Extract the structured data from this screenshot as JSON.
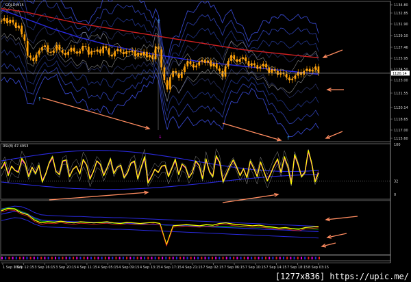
{
  "chart_data": [
    {
      "type": "line",
      "panel": "price",
      "title": "GOLD,M15",
      "ylim": [
        1105.5,
        1135.5
      ],
      "y_ticks": [
        "1134.80",
        "1132.85",
        "1131.90",
        "1129.10",
        "1127.46",
        "1125.95",
        "1124.50",
        "1123.00",
        "1121.55",
        "1120.14",
        "1118.65",
        "1117.00",
        "1115.60"
      ],
      "price_label": "1120.14",
      "series": [
        {
          "name": "",
          "color": "#ffa000",
          "values": [
            1131.5,
            1132.2,
            1131.0,
            1131.8,
            1131.2,
            1130.0,
            1130.5,
            1128.6,
            1127.2,
            1124.0,
            1123.5,
            1122.8,
            1124.2,
            1125.1,
            1125.8,
            1126.2,
            1124.8,
            1124.6,
            1125.1,
            1126.3,
            1125.2,
            1124.6,
            1124.1,
            1124.8,
            1125.7,
            1124.9,
            1124.4,
            1125.0,
            1126.1,
            1125.9,
            1124.2,
            1125.0,
            1124.8,
            1125.3,
            1124.5,
            1126.0,
            1125.6,
            1124.2,
            1123.8,
            1124.9,
            1125.4,
            1124.8,
            1124.3,
            1124.9,
            1124.7,
            1125.1,
            1123.8,
            1124.6,
            1124.0,
            1124.8,
            1123.6,
            1124.1,
            1123.2,
            1126.0,
            1125.3,
            1121.4,
            1118.6,
            1116.6,
            1119.3,
            1120.6,
            1120.2,
            1119.1,
            1120.4,
            1121.6,
            1122.8,
            1122.1,
            1121.4,
            1121.8,
            1122.6,
            1123.0,
            1122.4,
            1122.9,
            1121.6,
            1122.3,
            1121.2,
            1120.6,
            1119.4,
            1121.6,
            1122.8,
            1124.1,
            1123.2,
            1122.6,
            1123.2,
            1123.6,
            1122.8,
            1121.7,
            1122.3,
            1121.9,
            1121.1,
            1121.6,
            1122.2,
            1121.4,
            1120.2,
            1121.0,
            1120.6,
            1119.8,
            1120.3,
            1120.0,
            1119.2,
            1118.6,
            1118.9,
            1119.6,
            1120.4,
            1119.8,
            1120.6,
            1121.1,
            1120.5,
            1120.9,
            1121.6,
            1120.2
          ]
        },
        {
          "name": "",
          "color": "#d02020",
          "values": [
            1134.2,
            1134.0,
            1133.7,
            1133.4,
            1133.0,
            1132.6,
            1132.2,
            1131.8,
            1131.4,
            1131.0,
            1130.7,
            1130.4,
            1130.1,
            1129.8,
            1129.5,
            1129.2,
            1128.9,
            1128.6,
            1128.3,
            1128.0,
            1127.7,
            1127.4,
            1127.1,
            1126.8,
            1126.5,
            1126.2,
            1125.9,
            1125.6,
            1125.3,
            1125.1,
            1124.9,
            1124.7,
            1124.5,
            1124.3,
            1124.1,
            1123.9,
            1123.7,
            1123.5
          ]
        },
        {
          "name": "",
          "color": "#2a2ae0",
          "values": [
            1133.9,
            1133.3,
            1132.6,
            1131.9,
            1131.2,
            1130.5,
            1129.8,
            1129.2,
            1128.6,
            1128.0,
            1127.5,
            1127.0,
            1126.5,
            1126.1,
            1125.7,
            1125.3,
            1124.9,
            1124.5,
            1124.2,
            1123.9,
            1123.6,
            1123.3,
            1123.0,
            1122.7,
            1122.5,
            1122.3,
            1122.1,
            1121.9,
            1121.7,
            1121.5,
            1121.3,
            1121.1,
            1120.9,
            1120.7,
            1120.5,
            1120.3,
            1120.1,
            1119.9
          ]
        }
      ],
      "annotations": {
        "arrows_count": 6,
        "arrow_color": "#ff8c60",
        "top_arrow_color": "#3aa8ff"
      }
    },
    {
      "type": "line",
      "panel": "oscillator",
      "title": "RSI(8) 47.4953",
      "ylim": [
        0,
        100
      ],
      "y_ticks": [
        "100",
        "32",
        "0"
      ],
      "series": [
        {
          "name": "",
          "color": "#ffff00",
          "values": [
            55,
            68,
            42,
            60,
            52,
            48,
            75,
            65,
            40,
            58,
            46,
            62,
            30,
            45,
            66,
            78,
            50,
            44,
            70,
            72,
            40,
            54,
            60,
            45,
            73,
            62,
            35,
            50,
            70,
            64,
            42,
            56,
            74,
            46,
            58,
            62,
            38,
            48,
            66,
            70,
            36,
            58,
            78,
            28,
            40,
            54,
            48,
            60,
            62,
            40,
            56,
            73,
            44,
            64,
            58,
            38,
            48,
            70,
            62,
            36,
            74,
            50,
            40,
            80,
            68,
            30,
            45,
            60,
            72,
            58,
            42,
            55,
            38,
            70,
            56,
            40,
            68,
            50,
            32,
            46,
            62,
            74,
            48,
            78,
            60,
            26,
            82,
            64,
            40,
            48,
            90,
            66,
            30,
            47
          ]
        },
        {
          "name": "",
          "color": "#e000e0",
          "values": [
            57,
            64,
            46,
            60,
            52,
            50,
            72,
            64,
            42,
            58,
            47,
            61,
            32,
            45,
            65,
            76,
            50,
            45,
            69,
            71,
            41,
            54,
            60,
            46,
            72,
            62,
            37,
            50,
            70,
            63,
            43,
            56,
            73,
            47,
            58,
            61,
            39,
            48,
            66,
            69,
            37,
            58,
            76,
            30,
            41,
            54,
            48,
            60,
            61,
            41,
            56,
            71,
            45,
            63,
            57,
            39,
            48,
            69,
            61,
            37,
            73,
            50,
            41,
            78,
            67,
            31,
            46,
            60,
            71,
            57,
            43,
            55,
            39,
            69,
            56,
            41,
            67,
            50,
            33,
            47,
            61,
            73,
            48,
            76,
            60,
            28,
            80,
            63,
            41,
            48,
            88,
            65,
            31,
            48
          ]
        }
      ]
    },
    {
      "type": "line",
      "panel": "oscillator",
      "title": "",
      "series": [
        {
          "name": "",
          "color": "#ffff00",
          "values": [
            0.62,
            0.7,
            0.68,
            0.55,
            0.48,
            0.3,
            0.2,
            0.24,
            0.22,
            0.26,
            0.22,
            0.2,
            0.24,
            0.22,
            0.2,
            0.22,
            0.24,
            0.2,
            0.18,
            0.22,
            0.2,
            0.18,
            0.2,
            0.22,
            0.18,
            -0.55,
            0.1,
            0.12,
            0.14,
            0.12,
            0.1,
            0.14,
            0.12,
            0.18,
            0.2,
            0.16,
            0.14,
            0.12,
            0.1,
            0.12,
            0.08,
            0.06,
            0.02,
            0.04,
            0.0,
            -0.02,
            0.04,
            0.06,
            0.08
          ]
        },
        {
          "name": "",
          "color": "#2a2ae0",
          "values": [
            0.5,
            0.55,
            0.6,
            0.58,
            0.5,
            0.38,
            0.3,
            0.28,
            0.27,
            0.26,
            0.25,
            0.24,
            0.24,
            0.23,
            0.22,
            0.22,
            0.21,
            0.2,
            0.2,
            0.19,
            0.18,
            0.17,
            0.16,
            0.15,
            0.14,
            0.13,
            0.12,
            0.11,
            0.1,
            0.09,
            0.08,
            0.07,
            0.06,
            0.05,
            0.04,
            0.03,
            0.02,
            0.01,
            0.0,
            -0.01,
            -0.02,
            -0.03,
            -0.04,
            -0.05,
            -0.06,
            -0.07,
            -0.08,
            -0.09,
            -0.1
          ]
        },
        {
          "name": "",
          "color": "#00b000",
          "values": [
            0.66,
            0.72,
            0.7,
            0.6,
            0.52,
            0.35,
            0.26,
            0.25,
            0.24,
            0.24,
            0.23,
            0.22,
            0.22,
            0.21,
            0.21,
            0.2,
            0.2,
            0.19,
            0.18,
            0.18,
            0.17,
            0.16,
            0.15,
            0.15,
            0.14,
            0.12,
            0.12,
            0.11,
            0.11,
            0.1,
            0.1,
            0.09,
            0.09,
            0.08,
            0.08,
            0.07,
            0.06,
            0.06,
            0.05,
            0.05,
            0.04,
            0.03,
            0.02,
            0.02,
            0.01,
            0.0,
            0.0,
            -0.01,
            -0.02
          ]
        }
      ]
    }
  ],
  "x_ticks": [
    "1 Sep 2015",
    "3 Sep 12:15",
    "3 Sep 16:15",
    "3 Sep 20:15",
    "4 Sep 11:15",
    "4 Sep 05:15",
    "4 Sep 09:15",
    "4 Sep 13:15",
    "4 Sep 17:15",
    "4 Sep 21:15",
    "7 Sep 02:15",
    "7 Sep 06:15",
    "7 Sep 10:15",
    "7 Sep 14:15",
    "7 Sep 18:15",
    "8 Sep 03:15"
  ],
  "watermark": "[1277x836] https://upic.me/"
}
